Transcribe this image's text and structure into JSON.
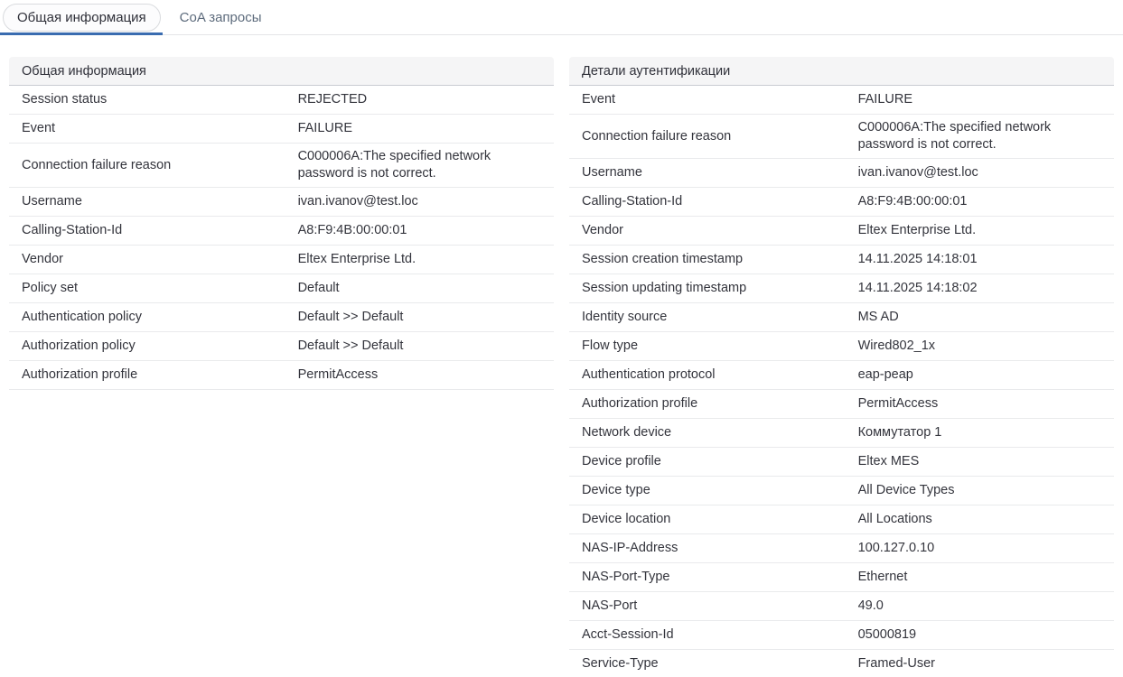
{
  "colors": {
    "accent": "#3a6cb0",
    "panel_header_bg": "#f5f5f6",
    "row_separator": "#e9eaec"
  },
  "tabs": [
    {
      "label": "Общая информация",
      "active": true
    },
    {
      "label": "CoA запросы",
      "active": false
    }
  ],
  "panels": [
    {
      "title": "Общая информация",
      "rows": [
        {
          "label": "Session status",
          "value": "REJECTED"
        },
        {
          "label": "Event",
          "value": "FAILURE"
        },
        {
          "label": "Connection failure reason",
          "value": "C000006A:The specified network password is not correct."
        },
        {
          "label": "Username",
          "value": "ivan.ivanov@test.loc"
        },
        {
          "label": "Calling-Station-Id",
          "value": "A8:F9:4B:00:00:01"
        },
        {
          "label": "Vendor",
          "value": "Eltex Enterprise Ltd."
        },
        {
          "label": "Policy set",
          "value": "Default"
        },
        {
          "label": "Authentication policy",
          "value": "Default >> Default"
        },
        {
          "label": "Authorization policy",
          "value": "Default >> Default"
        },
        {
          "label": "Authorization profile",
          "value": "PermitAccess"
        }
      ]
    },
    {
      "title": "Детали аутентификации",
      "rows": [
        {
          "label": "Event",
          "value": "FAILURE"
        },
        {
          "label": "Connection failure reason",
          "value": "C000006A:The specified network password is not correct."
        },
        {
          "label": "Username",
          "value": "ivan.ivanov@test.loc"
        },
        {
          "label": "Calling-Station-Id",
          "value": "A8:F9:4B:00:00:01"
        },
        {
          "label": "Vendor",
          "value": "Eltex Enterprise Ltd."
        },
        {
          "label": "Session creation timestamp",
          "value": "14.11.2025 14:18:01"
        },
        {
          "label": "Session updating timestamp",
          "value": "14.11.2025 14:18:02"
        },
        {
          "label": "Identity source",
          "value": "MS AD"
        },
        {
          "label": "Flow type",
          "value": "Wired802_1x"
        },
        {
          "label": "Authentication protocol",
          "value": "eap-peap"
        },
        {
          "label": "Authorization profile",
          "value": "PermitAccess"
        },
        {
          "label": "Network device",
          "value": "Коммутатор 1"
        },
        {
          "label": "Device profile",
          "value": "Eltex MES"
        },
        {
          "label": "Device type",
          "value": "All Device Types"
        },
        {
          "label": "Device location",
          "value": "All Locations"
        },
        {
          "label": "NAS-IP-Address",
          "value": "100.127.0.10"
        },
        {
          "label": "NAS-Port-Type",
          "value": "Ethernet"
        },
        {
          "label": "NAS-Port",
          "value": "49.0"
        },
        {
          "label": "Acct-Session-Id",
          "value": "05000819"
        },
        {
          "label": "Service-Type",
          "value": "Framed-User"
        }
      ]
    }
  ]
}
